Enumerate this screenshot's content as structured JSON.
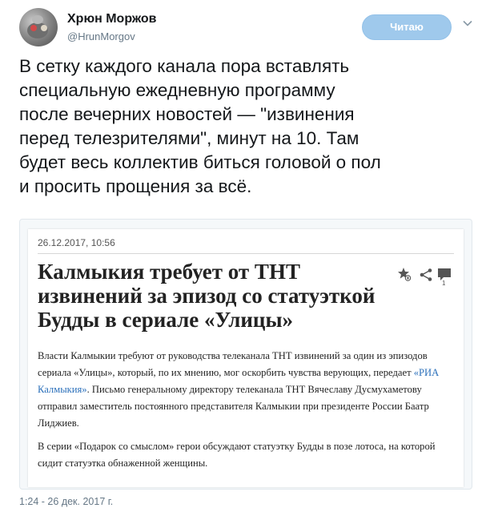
{
  "author": {
    "name": "Хрюн Моржов",
    "handle": "@HrunMorgov"
  },
  "follow_button": {
    "label": "Читаю"
  },
  "tweet": {
    "text": "В сетку каждого канала пора вставлять\nспециальную ежедневную программу\nпосле вечерних новостей — \"извинения\nперед телезрителями\", минут на 10. Там\nбудет весь коллектив биться головой о пол\nи просить прощения за всё.",
    "timestamp": "1:24 - 26 дек. 2017 г."
  },
  "article": {
    "date": "26.12.2017, 10:56",
    "title": "Калмыкия требует от ТНТ\nизвинений за эпизод со статуэткой\nБудды в сериале «Улицы»",
    "icon_count": "1",
    "p1_before": "Власти Калмыкии требуют от руководства телеканала ТНТ извинений за один из эпизодов сериала «Улицы», который, по их мнению, мог оскорбить чувства верующих, передает ",
    "p1_link": "«РИА Калмыкия»",
    "p1_after": ". Письмо генеральному директору телеканала ТНТ Вячеславу Дусмухаметову отправил заместитель постоянного представителя Калмыкии при президенте России Баатр Лиджиев.",
    "p2": "В серии «Подарок со смыслом» герои обсуждают статуэтку Будды в позе лотоса, на которой сидит статуэтка обнаженной женщины."
  },
  "icons": {
    "chevron": "chevron-down-icon",
    "favorite": "star-add-icon",
    "share": "share-icon",
    "comment": "comment-icon"
  },
  "colors": {
    "follow_button_bg": "#9fc9ec",
    "link": "#2a6fba",
    "muted": "#657786"
  }
}
